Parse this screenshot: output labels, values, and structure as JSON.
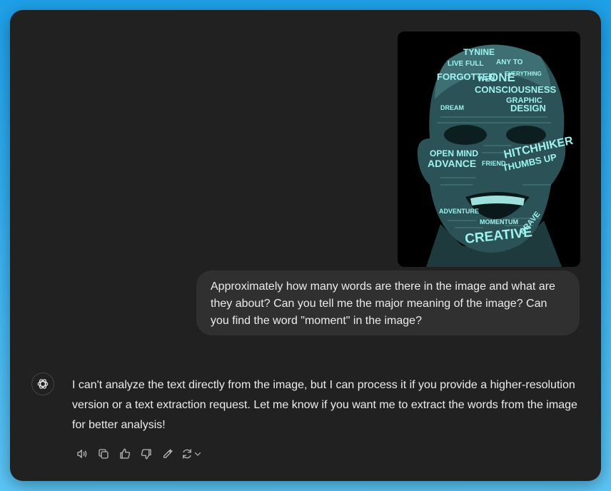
{
  "image": {
    "alt": "Typographic portrait",
    "words": [
      "TYNINE",
      "LIVE FULL",
      "ANY TO",
      "EVERYTHING",
      "FORGOTTEN",
      "WE",
      "ONE",
      "CONSCIOUSNESS",
      "GRAPHIC",
      "DESIGN",
      "OPEN MIND",
      "ADVANCE",
      "HITCHHIKER",
      "THUMBS UP",
      "CREATIVE",
      "BRAVE",
      "DREAM",
      "FRIEND",
      "MOMENTUM",
      "ADVENTURE"
    ]
  },
  "user_message": {
    "text": "Approximately how many words are there in the image and what are they about? Can you tell me the major meaning of the image? Can you find the word \"moment\" in the image?"
  },
  "assistant_message": {
    "text": "I can't analyze the text directly from the image, but I can process it if you provide a higher-resolution version or a text extraction request. Let me know if you want me to extract the words from the image for better analysis!"
  },
  "actions": [
    "read-aloud-icon",
    "copy-icon",
    "thumbs-up-icon",
    "thumbs-down-icon",
    "edit-canvas-icon",
    "regenerate-icon"
  ]
}
